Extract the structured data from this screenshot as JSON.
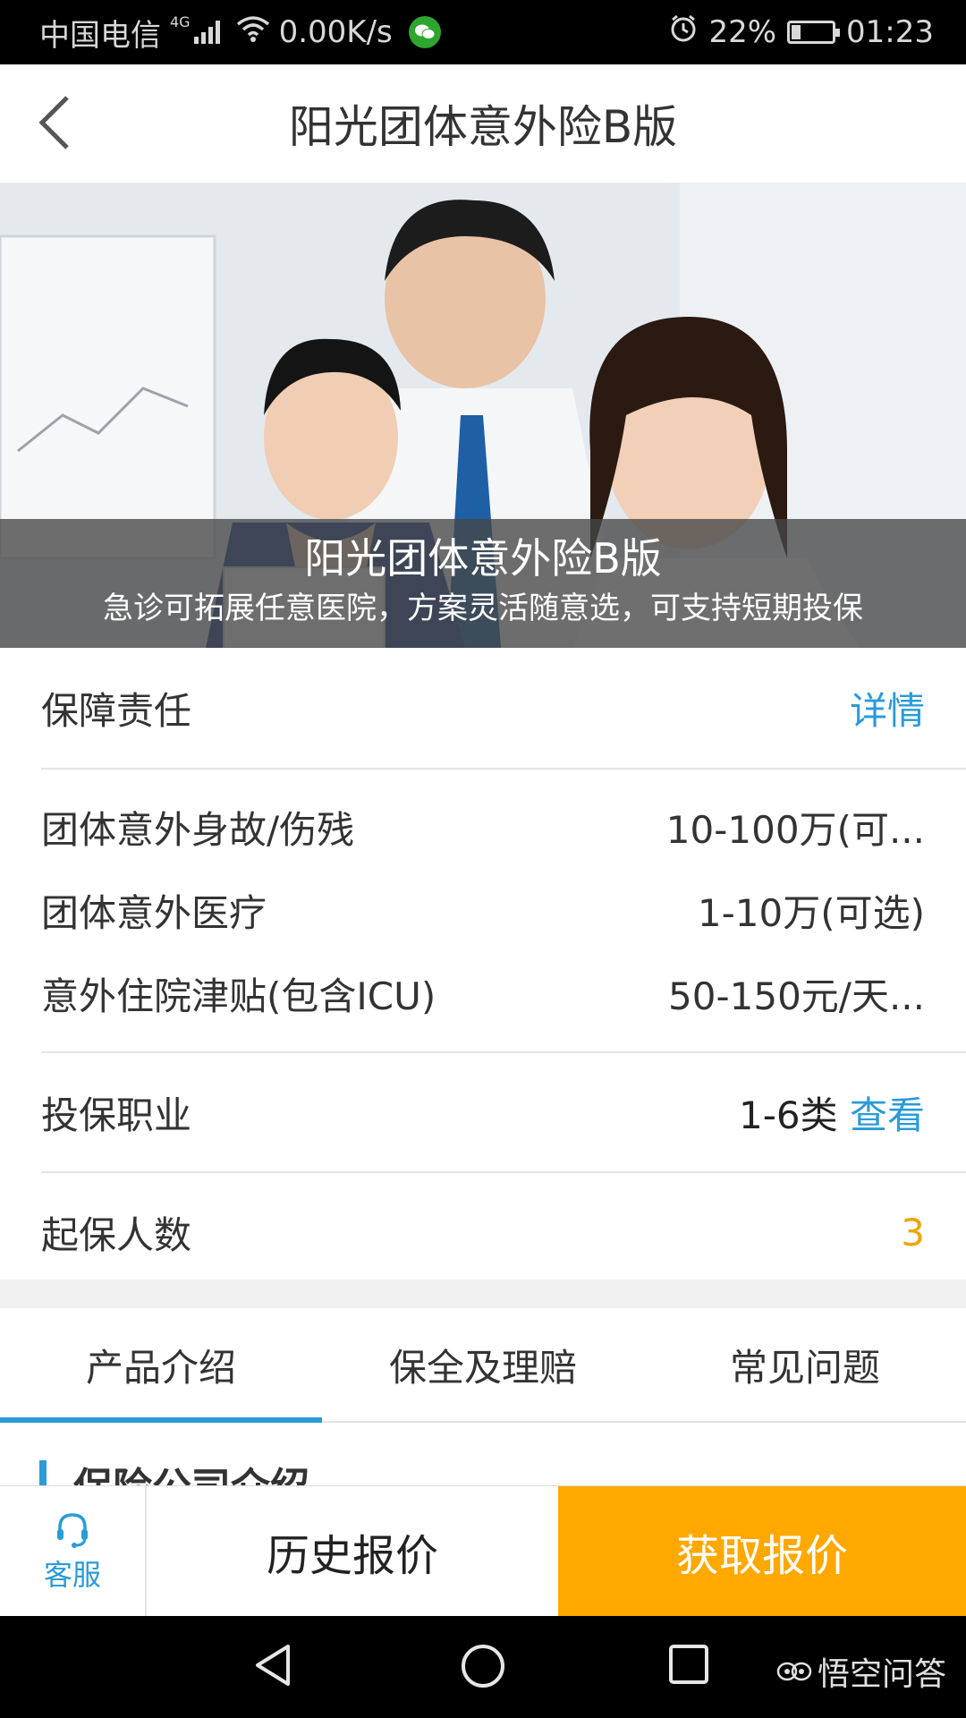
{
  "status_bar": {
    "carrier": "中国电信",
    "network": "4G",
    "speed": "0.00K/s",
    "battery": "22%",
    "battery_level": 0.22,
    "time": "01:23"
  },
  "nav": {
    "title": "阳光团体意外险B版"
  },
  "banner": {
    "title": "阳光团体意外险B版",
    "subtitle": "急诊可拓展任意医院，方案灵活随意选，可支持短期投保"
  },
  "coverage": {
    "header_label": "保障责任",
    "details_link": "详情",
    "items": [
      {
        "label": "团体意外身故/伤残",
        "value": "10-100万(可..."
      },
      {
        "label": "团体意外医疗",
        "value": "1-10万(可选)"
      },
      {
        "label": "意外住院津贴(包含ICU)",
        "value": "50-150元/天..."
      }
    ]
  },
  "occupation": {
    "label": "投保职业",
    "value": "1-6类",
    "link": "查看"
  },
  "min_insured": {
    "label": "起保人数",
    "value": "3"
  },
  "tabs": [
    {
      "label": "产品介绍",
      "active": true
    },
    {
      "label": "保全及理赔",
      "active": false
    },
    {
      "label": "常见问题",
      "active": false
    }
  ],
  "section": {
    "title": "保险公司介绍"
  },
  "actions": {
    "service_label": "客服",
    "history_label": "历史报价",
    "quote_label": "获取报价"
  },
  "watermark": "悟空问答",
  "colors": {
    "accent_blue": "#2a9bd8",
    "quote_orange": "#ffa800",
    "count_orange": "#f0a500"
  }
}
